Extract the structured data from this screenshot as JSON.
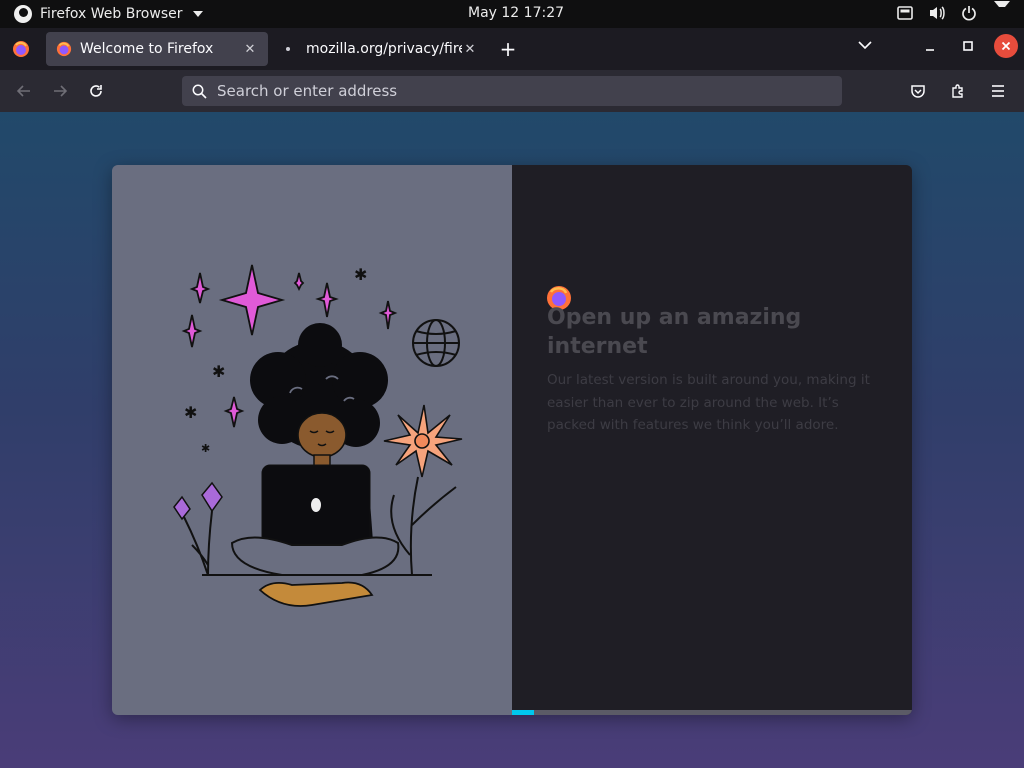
{
  "topbar": {
    "app_name": "Firefox Web Browser",
    "clock": "May 12  17:27",
    "tray_icons": [
      "screen-icon",
      "volume-icon",
      "power-icon",
      "caret-down-icon"
    ]
  },
  "tabs": [
    {
      "title": "Welcome to Firefox",
      "active": true
    },
    {
      "title": "mozilla.org/privacy/firefox",
      "active": false
    }
  ],
  "urlbar": {
    "placeholder": "Search or enter address",
    "value": ""
  },
  "onboarding": {
    "headline": "Open up an amazing internet",
    "subtext": "Our latest version is built around you, making it easier than ever to zip around the web. It’s packed with features we think you’ll adore.",
    "progress_fraction": 0.055
  },
  "colors": {
    "accent": "#00c8ee",
    "window_close": "#e74c3c",
    "illustration_panel": "#6a6e80",
    "text_panel": "#1f1e25"
  }
}
